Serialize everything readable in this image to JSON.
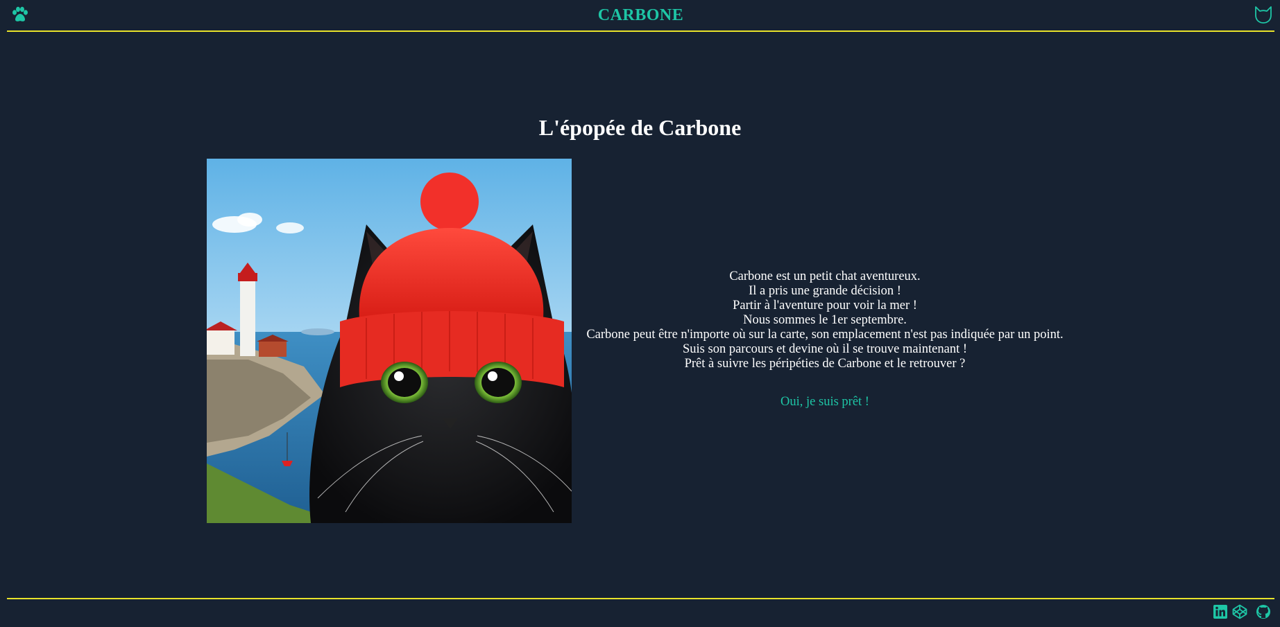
{
  "header": {
    "brand": "CARBONE",
    "left_icon": "paw-icon",
    "right_icon": "cat-head-icon",
    "accent_color": "#1ec6a6",
    "divider_color": "#e9e42a"
  },
  "main": {
    "title": "L'épopée de Carbone",
    "image_alt": "Black kitten wearing a red beanie in front of a seaside lighthouse",
    "story_lines": [
      "Carbone est un petit chat aventureux.",
      "Il a pris une grande décision !",
      "Partir à l'aventure pour voir la mer !",
      "Nous sommes le 1er septembre.",
      "Carbone peut être n'importe où sur la carte, son emplacement n'est pas indiquée par un point.",
      "Suis son parcours et devine où il se trouve maintenant !",
      "Prêt à suivre les péripéties de Carbone et le retrouver ?"
    ],
    "cta_label": "Oui, je suis prêt !"
  },
  "footer": {
    "icons": [
      "linkedin-icon",
      "codepen-icon",
      "github-icon"
    ]
  },
  "colors": {
    "background": "#172232",
    "text": "#ffffff"
  }
}
